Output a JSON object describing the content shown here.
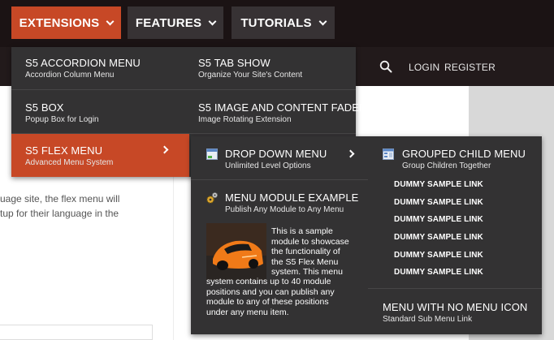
{
  "nav": {
    "items": [
      {
        "label": "EXTENSIONS",
        "active": true
      },
      {
        "label": "FEATURES",
        "active": false
      },
      {
        "label": "TUTORIALS",
        "active": false
      }
    ]
  },
  "util": {
    "login": "LOGIN",
    "register": "REGISTER",
    "search_icon": "search-icon"
  },
  "background": {
    "text_lines": [
      "uage site, the flex menu will",
      "tup for their language in the"
    ]
  },
  "dropdown1": {
    "items": [
      {
        "title": "S5 ACCORDION MENU",
        "subtitle": "Accordion Column Menu"
      },
      {
        "title": "S5 TAB SHOW",
        "subtitle": "Organize Your Site's Content"
      },
      {
        "title": "S5 BOX",
        "subtitle": "Popup Box for Login"
      },
      {
        "title": "S5 IMAGE AND CONTENT FADER",
        "subtitle": "Image Rotating Extension"
      },
      {
        "title": "S5 FLEX MENU",
        "subtitle": "Advanced Menu System"
      }
    ]
  },
  "dropdown2": {
    "drop_down": {
      "title": "DROP DOWN MENU",
      "subtitle": "Unlimited Level Options"
    },
    "module_example": {
      "title": "MENU MODULE EXAMPLE",
      "subtitle": "Publish Any Module to Any Menu"
    },
    "module_text": [
      "This is a sample",
      "module to showcase",
      "the functionality of",
      "the S5 Flex Menu",
      "system. This menu",
      "system contains up to 40 module",
      "positions and you can publish any",
      "module to any of these positions",
      "under any menu item."
    ],
    "grouped": {
      "title": "GROUPED CHILD MENU",
      "subtitle": "Group Children Together"
    },
    "dummy_links": [
      "DUMMY SAMPLE LINK",
      "DUMMY SAMPLE LINK",
      "DUMMY SAMPLE LINK",
      "DUMMY SAMPLE LINK",
      "DUMMY SAMPLE LINK",
      "DUMMY SAMPLE LINK"
    ],
    "no_icon": {
      "title": "MENU WITH NO MENU ICON",
      "subtitle": "Standard Sub Menu Link"
    }
  },
  "colors": {
    "accent": "#c74826",
    "panel": "#333233",
    "nav": "#373234"
  }
}
